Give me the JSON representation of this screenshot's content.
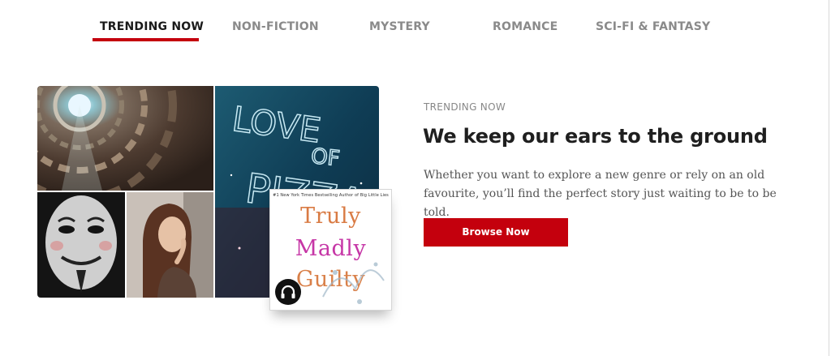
{
  "tabs": [
    {
      "label": "TRENDING NOW",
      "active": true
    },
    {
      "label": "NON-FICTION",
      "active": false
    },
    {
      "label": "MYSTERY",
      "active": false
    },
    {
      "label": "ROMANCE",
      "active": false
    },
    {
      "label": "SCI-FI & FANTASY",
      "active": false
    }
  ],
  "hero": {
    "eyebrow": "TRENDING NOW",
    "headline": "We keep our ears to the ground",
    "body": "Whether you want to explore a new genre or rely on an old favourite, you’ll find the perfect story just waiting to be to be told.",
    "cta_label": "Browse Now"
  },
  "collage": {
    "images": [
      {
        "name": "cathedral-dome-photo"
      },
      {
        "name": "neon-love-of-pizza-photo",
        "neon_text": [
          "LOVE",
          "OF",
          "PIZZA"
        ]
      },
      {
        "name": "guy-fawkes-mask-photo"
      },
      {
        "name": "woman-portrait-photo"
      }
    ]
  },
  "book": {
    "tagline": "#1 New York Times Bestselling Author of Big Little Lies",
    "title_words": [
      "Truly",
      "Madly",
      "Guilty"
    ],
    "badge_icon": "headphones-icon"
  },
  "colors": {
    "accent": "#c4000d",
    "tab_inactive": "#8a8a8a",
    "tab_active": "#1a1a1a"
  }
}
